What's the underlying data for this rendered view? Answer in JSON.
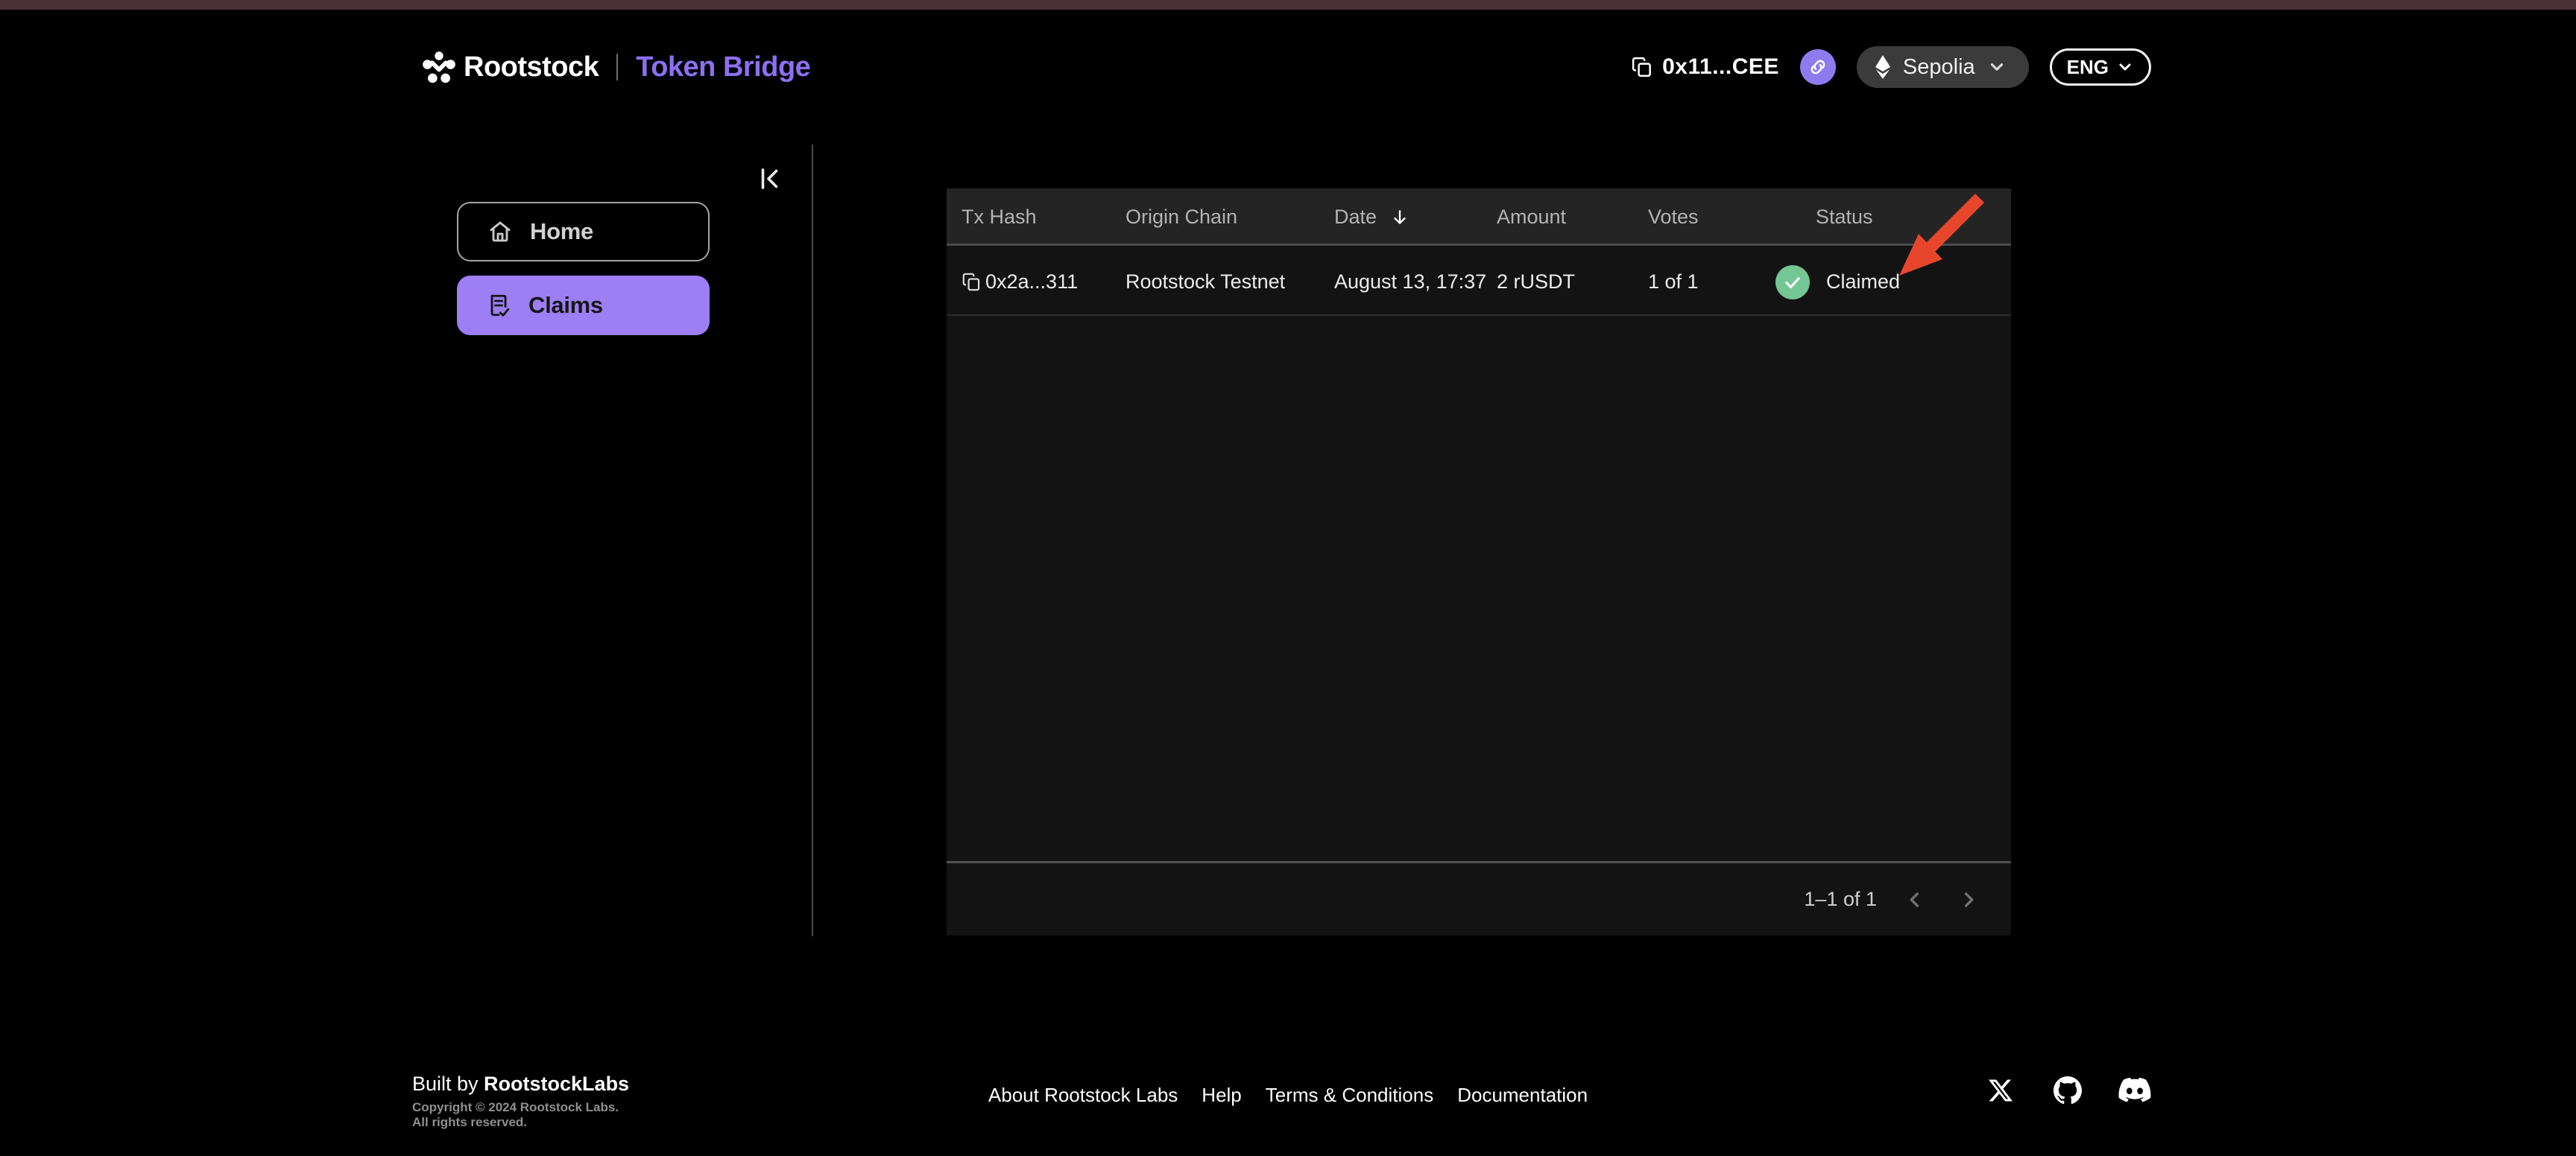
{
  "header": {
    "brand": "Rootstock",
    "product": "Token Bridge",
    "wallet": {
      "address": "0x11...CEE"
    },
    "network": {
      "name": "Sepolia"
    },
    "language": {
      "selected": "ENG"
    }
  },
  "sidebar": {
    "items": [
      {
        "label": "Home",
        "active": false
      },
      {
        "label": "Claims",
        "active": true
      }
    ]
  },
  "claims_table": {
    "columns": [
      "Tx Hash",
      "Origin Chain",
      "Date",
      "Amount",
      "Votes",
      "Status"
    ],
    "sorted_by": "Date",
    "sort_direction": "desc",
    "rows": [
      {
        "tx_hash": "0x2a...311",
        "origin_chain": "Rootstock Testnet",
        "date": "August 13, 17:37",
        "amount": "2 rUSDT",
        "votes": "1 of 1",
        "status": "Claimed"
      }
    ],
    "pagination": {
      "label": "1–1 of 1"
    }
  },
  "footer": {
    "built_by_prefix": "Built by ",
    "built_by_brand": "RootstockLabs",
    "copyright_line1": "Copyright © 2024 Rootstock Labs.",
    "copyright_line2": "All rights reserved.",
    "links": [
      "About Rootstock Labs",
      "Help",
      "Terms & Conditions",
      "Documentation"
    ],
    "social_icons": [
      "x-twitter-icon",
      "github-icon",
      "discord-icon"
    ]
  },
  "colors": {
    "accent_purple": "#8d6ff0",
    "button_purple": "#9d7ef5",
    "status_green": "#74c795",
    "annotation_red": "#e8462c",
    "topbar_maroon": "#4a3137",
    "table_bg": "#131313",
    "table_header_bg": "#242424"
  }
}
